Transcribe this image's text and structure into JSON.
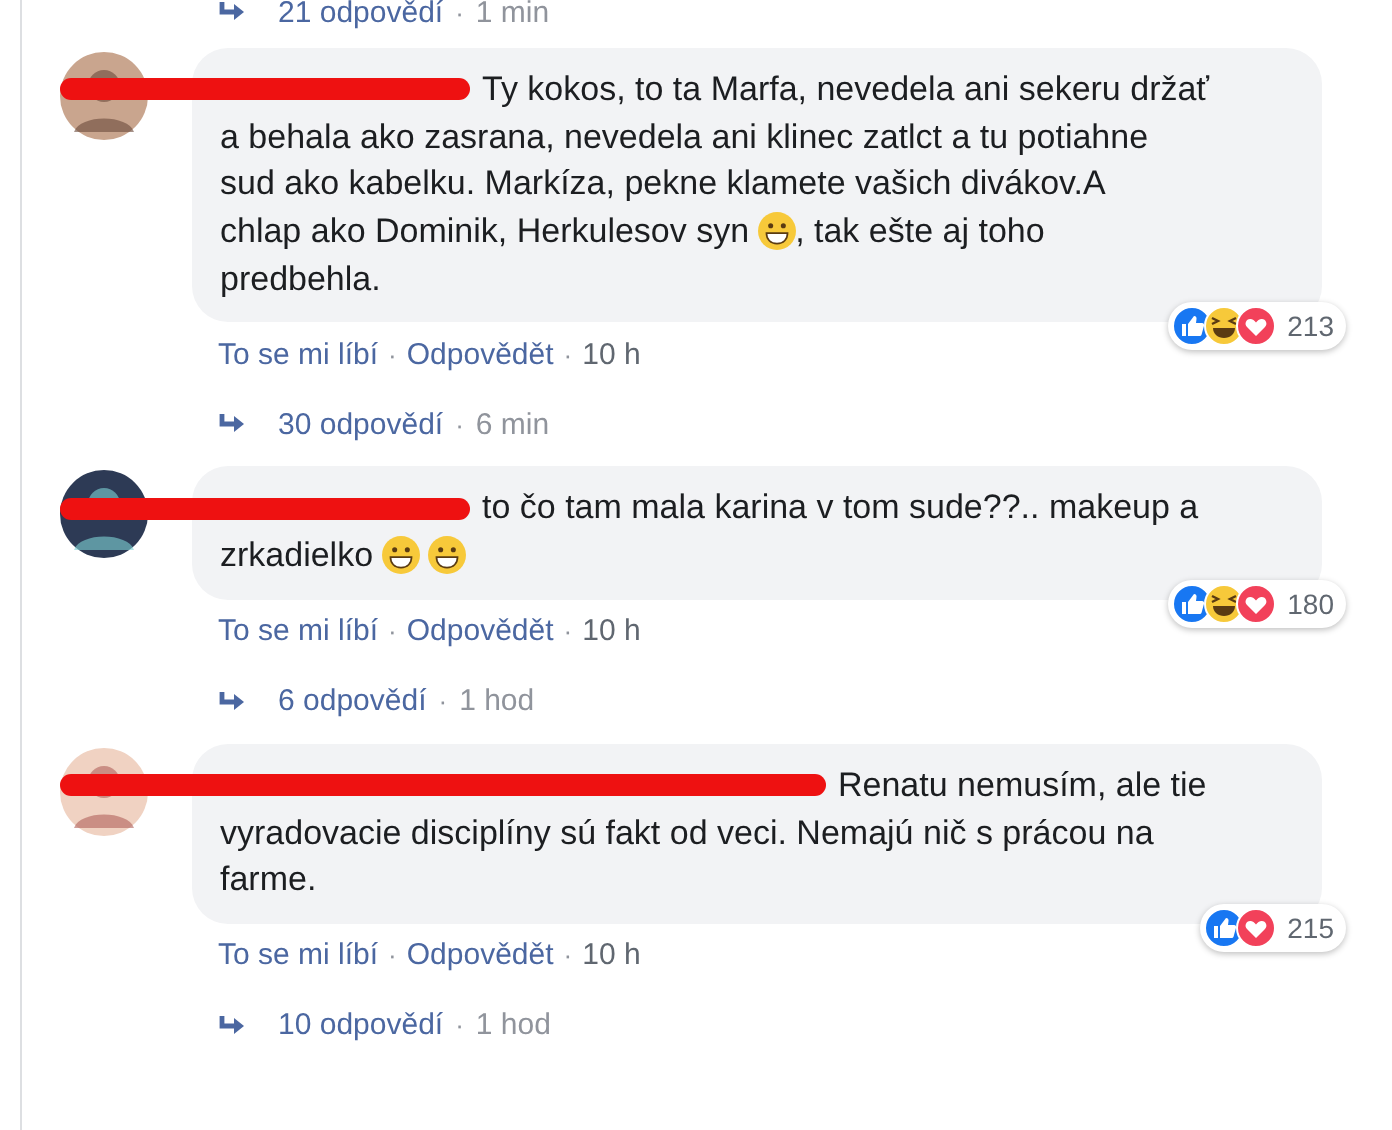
{
  "top_replies": {
    "count": "21 odpovědí",
    "separator": "·",
    "time": "1 min"
  },
  "comments": [
    {
      "lines": [
        [
          {
            "kind": "text",
            "text": "Ty kokos, to ta Marfa, nevedela ani sekeru držať"
          }
        ],
        [
          {
            "kind": "text",
            "text": "a behala ako zasrana, nevedela ani klinec zatlct a tu potiahne"
          }
        ],
        [
          {
            "kind": "text",
            "text": "sud ako kabelku. Markíza, pekne klamete vašich divákov.A"
          }
        ],
        [
          {
            "kind": "text",
            "text": "chlap ako Dominik, Herkulesov syn"
          },
          {
            "kind": "emoji"
          },
          {
            "kind": "text",
            "text": ", tak ešte aj toho"
          }
        ],
        [
          {
            "kind": "text",
            "text": "predbehla."
          }
        ]
      ],
      "reactions": [
        {
          "kind": "like"
        },
        {
          "kind": "haha"
        },
        {
          "kind": "love"
        }
      ],
      "reaction_count": "213",
      "meta": [
        {
          "kind": "link",
          "text": "To se mi líbí"
        },
        {
          "kind": "separator",
          "text": "·"
        },
        {
          "kind": "link",
          "text": "Odpovědět"
        },
        {
          "kind": "separator",
          "text": "·"
        },
        {
          "kind": "time",
          "text": "10 h"
        }
      ],
      "replies": {
        "count": "30 odpovědí",
        "separator": "·",
        "time": "6 min"
      }
    },
    {
      "lines": [
        [
          {
            "kind": "text",
            "text": "to čo tam mala karina v tom sude??.. makeup a"
          }
        ],
        [
          {
            "kind": "text",
            "text": "zrkadielko"
          },
          {
            "kind": "emoji"
          },
          {
            "kind": "emoji"
          }
        ]
      ],
      "reactions": [
        {
          "kind": "like"
        },
        {
          "kind": "haha"
        },
        {
          "kind": "love"
        }
      ],
      "reaction_count": "180",
      "meta": [
        {
          "kind": "link",
          "text": "To se mi líbí"
        },
        {
          "kind": "separator",
          "text": "·"
        },
        {
          "kind": "link",
          "text": "Odpovědět"
        },
        {
          "kind": "separator",
          "text": "·"
        },
        {
          "kind": "time",
          "text": "10 h"
        }
      ],
      "replies": {
        "count": "6 odpovědí",
        "separator": "·",
        "time": "1 hod"
      }
    },
    {
      "lines": [
        [
          {
            "kind": "text",
            "text": "Renatu nemusím, ale tie"
          }
        ],
        [
          {
            "kind": "text",
            "text": "vyradovacie disciplíny sú fakt od veci. Nemajú nič s prácou na"
          }
        ],
        [
          {
            "kind": "text",
            "text": "farme."
          }
        ]
      ],
      "reactions": [
        {
          "kind": "like"
        },
        {
          "kind": "love"
        }
      ],
      "reaction_count": "215",
      "meta": [
        {
          "kind": "link",
          "text": "To se mi líbí"
        },
        {
          "kind": "separator",
          "text": "·"
        },
        {
          "kind": "link",
          "text": "Odpovědět"
        },
        {
          "kind": "separator",
          "text": "·"
        },
        {
          "kind": "time",
          "text": "10 h"
        }
      ],
      "replies": {
        "count": "10 odpovědí",
        "separator": "·",
        "time": "1 hod"
      }
    }
  ]
}
